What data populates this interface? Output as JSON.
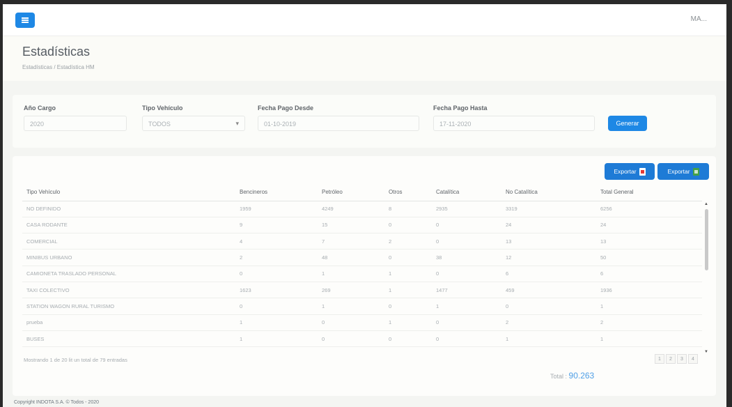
{
  "topbar": {
    "user": "MA..."
  },
  "header": {
    "title": "Estadísticas",
    "breadcrumb": "Estadísticas / Estadística HM"
  },
  "filters": {
    "anio_label": "Año Cargo",
    "anio_value": "2020",
    "tipo_label": "Tipo Vehículo",
    "tipo_value": "TODOS",
    "desde_label": "Fecha Pago Desde",
    "desde_value": "01-10-2019",
    "hasta_label": "Fecha Pago Hasta",
    "hasta_value": "17-11-2020",
    "generar_label": "Generar"
  },
  "export": {
    "pdf_label": "Exportar",
    "excel_label": "Exportar"
  },
  "table": {
    "headers": [
      "Tipo Vehículo",
      "Bencineros",
      "Petróleo",
      "Otros",
      "Catalítica",
      "No Catalítica",
      "Total General"
    ],
    "rows": [
      [
        "NO DEFINIDO",
        "1959",
        "4249",
        "8",
        "2935",
        "3319",
        "6256"
      ],
      [
        "CASA RODANTE",
        "9",
        "15",
        "0",
        "0",
        "24",
        "24"
      ],
      [
        "COMERCIAL",
        "4",
        "7",
        "2",
        "0",
        "13",
        "13"
      ],
      [
        "MINIBUS URBANO",
        "2",
        "48",
        "0",
        "38",
        "12",
        "50"
      ],
      [
        "CAMIONETA TRASLADO PERSONAL",
        "0",
        "1",
        "1",
        "0",
        "6",
        "6"
      ],
      [
        "TAXI COLECTIVO",
        "1623",
        "269",
        "1",
        "1477",
        "459",
        "1936"
      ],
      [
        "STATION WAGON RURAL TURISMO",
        "0",
        "1",
        "0",
        "1",
        "0",
        "1"
      ],
      [
        "prueba",
        "1",
        "0",
        "1",
        "0",
        "2",
        "2"
      ],
      [
        "BUSES",
        "1",
        "0",
        "0",
        "0",
        "1",
        "1"
      ]
    ]
  },
  "showing": "Mostrando 1 de 20 lit un total de 79 entradas",
  "pager": [
    "1",
    "2",
    "3",
    "4"
  ],
  "total": {
    "label": "Total :",
    "value": "90.263"
  },
  "footer": "Copyright INDOTA S.A. © Todos - 2020",
  "colors": {
    "primary": "#1e88e5",
    "accent": "#4f9fe6"
  }
}
